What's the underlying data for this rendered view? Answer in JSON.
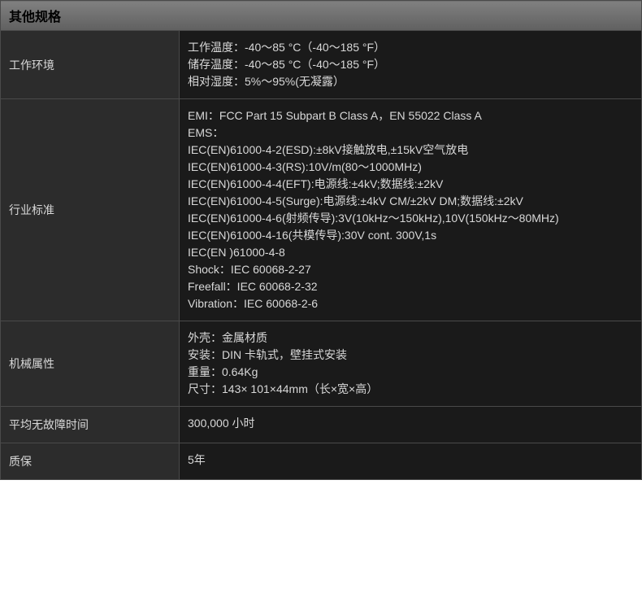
{
  "header": "其他规格",
  "rows": [
    {
      "label": "工作环境",
      "lines": [
        "工作温度：-40～85 °C（-40～185 °F）",
        "储存温度：-40～85 °C（-40～185 °F）",
        "相对湿度：5%～95%(无凝露）"
      ]
    },
    {
      "label": "行业标准",
      "lines": [
        "EMI：FCC Part 15 Subpart B Class A，EN 55022 Class A",
        "EMS：",
        "IEC(EN)61000-4-2(ESD):±8kV接触放电,±15kV空气放电",
        "IEC(EN)61000-4-3(RS):10V/m(80～1000MHz)",
        "IEC(EN)61000-4-4(EFT):电源线:±4kV;数据线:±2kV",
        "IEC(EN)61000-4-5(Surge):电源线:±4kV CM/±2kV DM;数据线:±2kV",
        "IEC(EN)61000-4-6(射频传导):3V(10kHz～150kHz),10V(150kHz～80MHz)",
        "IEC(EN)61000-4-16(共模传导):30V cont. 300V,1s",
        "IEC(EN )61000-4-8",
        "Shock：IEC 60068-2-27",
        "Freefall：IEC 60068-2-32",
        "Vibration：IEC 60068-2-6"
      ]
    },
    {
      "label": "机械属性",
      "lines": [
        "外壳：金属材质",
        "安装：DIN 卡轨式，壁挂式安装",
        "重量：0.64Kg",
        "尺寸：143× 101×44mm（长×宽×高）"
      ]
    },
    {
      "label": "平均无故障时间",
      "lines": [
        "300,000 小时"
      ]
    },
    {
      "label": "质保",
      "lines": [
        "5年"
      ]
    }
  ]
}
